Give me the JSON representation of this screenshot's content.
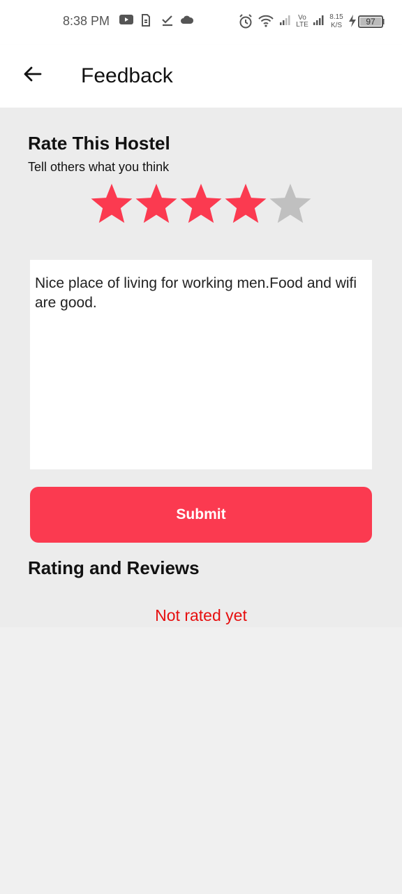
{
  "status_bar": {
    "time": "8:38 PM",
    "network_type": "Vo\nLTE",
    "speed_value": "8.15",
    "speed_unit": "K/S",
    "battery": "97",
    "icons": [
      "youtube-icon",
      "sim-icon",
      "check-icon",
      "cloud-icon",
      "alarm-icon",
      "wifi-icon",
      "signal-icon",
      "signal-icon",
      "charging-icon",
      "battery-icon"
    ]
  },
  "app_bar": {
    "title": "Feedback"
  },
  "rating": {
    "title": "Rate This Hostel",
    "subtitle": "Tell others what you think",
    "value": 4,
    "max": 5,
    "filled_color": "#fb3a50",
    "empty_color": "#c0c0c0"
  },
  "review": {
    "text": "Nice place of living for working men.Food and wifi are good."
  },
  "submit": {
    "label": "Submit",
    "color": "#fb3a50"
  },
  "reviews_section": {
    "title": "Rating and Reviews",
    "empty_message": "Not rated yet",
    "empty_color": "#e60f0f"
  }
}
